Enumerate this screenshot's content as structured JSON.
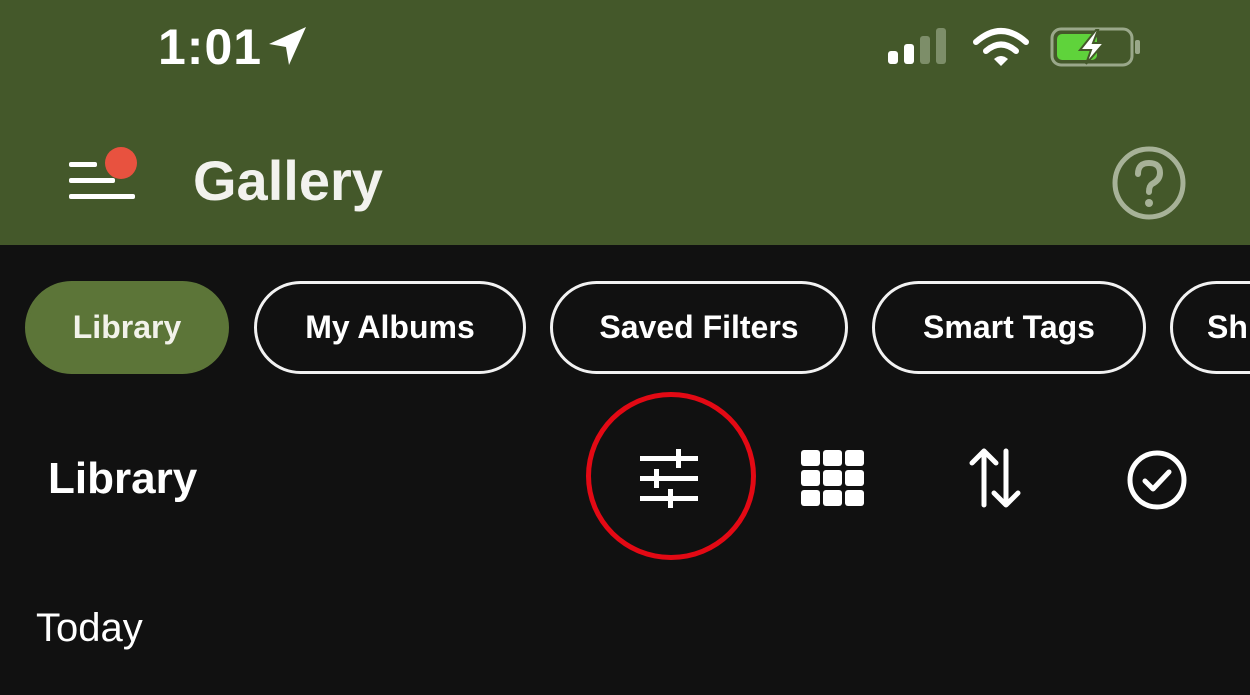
{
  "status_bar": {
    "time": "1:01",
    "icons": [
      "location-arrow-icon",
      "cellular-signal-icon",
      "wifi-icon",
      "battery-charging-icon"
    ]
  },
  "header": {
    "title": "Gallery",
    "background_color": "#44582a",
    "notification_dot_color": "#e8523f",
    "menu_icon": "hamburger-menu-icon",
    "help_icon": "question-mark-icon"
  },
  "tabs": [
    {
      "label": "Library",
      "active": true
    },
    {
      "label": "My Albums",
      "active": false
    },
    {
      "label": "Saved Filters",
      "active": false
    },
    {
      "label": "Smart Tags",
      "active": false
    },
    {
      "label": "Sh",
      "active": false
    }
  ],
  "toolbar": {
    "title": "Library",
    "actions": [
      "filter-sliders-icon",
      "grid-view-icon",
      "sort-arrows-icon",
      "select-check-icon"
    ],
    "highlight_color": "#e30914"
  },
  "content": {
    "section_label": "Today"
  }
}
